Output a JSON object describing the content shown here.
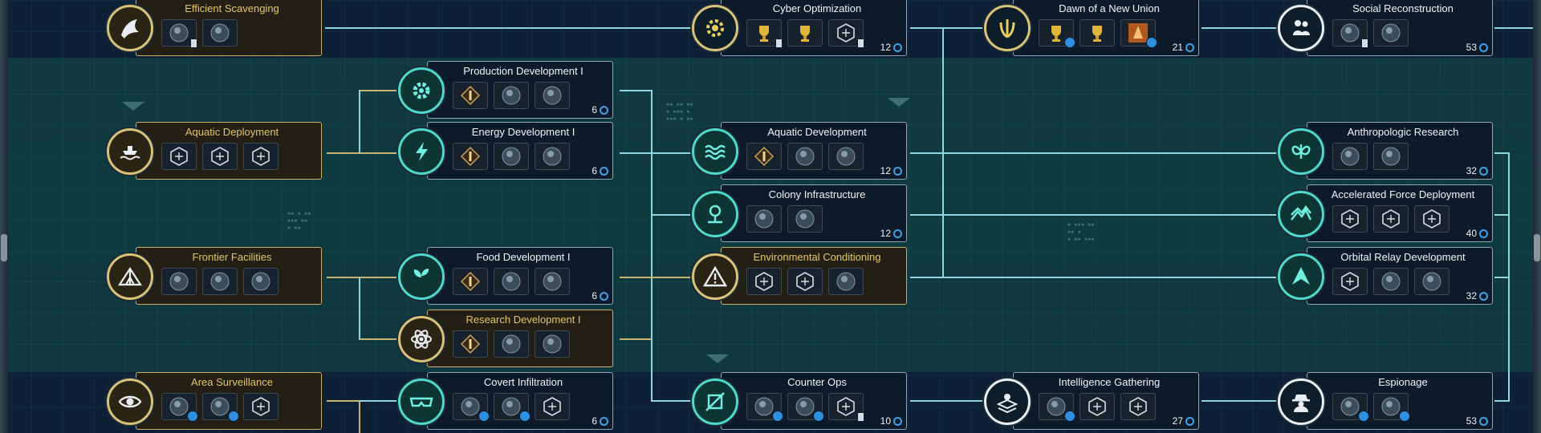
{
  "colors": {
    "completed_border": "#c9b06a",
    "completed_title": "#e3c667",
    "node_border": "#8da7b6",
    "link_cyan": "#8fd6e0",
    "link_gold": "#c9b470",
    "turn_icon": "#3ea2e8"
  },
  "nodes": {
    "efficient_scavenging": {
      "title": "Efficient Scavenging",
      "icon": "scavenger-bird-icon",
      "chips": [
        "atom-lab-icon",
        "skull-claw-icon"
      ]
    },
    "cyber_optimization": {
      "title": "Cyber Optimization",
      "icon": "gear-chip-icon",
      "chips": [
        "gold-crown-icon",
        "gold-gear-icon",
        "hex-cylinder-icon"
      ],
      "turns": "12"
    },
    "dawn_new_union": {
      "title": "Dawn of a New Union",
      "icon": "laurel-union-icon",
      "chips": [
        "trophy-icon",
        "trophy-icon",
        "orange-rocket-icon"
      ],
      "turns": "21"
    },
    "social_reconstruction": {
      "title": "Social Reconstruction",
      "icon": "people-cluster-icon",
      "chips": [
        "scaffold-icon",
        "sphere-icon"
      ],
      "turns": "53"
    },
    "production_dev_1": {
      "title": "Production Development I",
      "icon": "gear-icon",
      "chips": [
        "tier-one-badge-icon",
        "mine-icon",
        "factory-icon"
      ],
      "turns": "6"
    },
    "aquatic_deployment": {
      "title": "Aquatic Deployment",
      "icon": "ship-waves-icon",
      "chips": [
        "hex-building-icon",
        "hex-diamond-icon",
        "hex-cross-icon"
      ]
    },
    "energy_dev_1": {
      "title": "Energy Development I",
      "icon": "lightning-icon",
      "chips": [
        "tier-one-badge-icon",
        "solar-array-icon",
        "reactor-icon"
      ],
      "turns": "6"
    },
    "aquatic_development": {
      "title": "Aquatic Development",
      "icon": "waves-icon",
      "chips": [
        "tier-one-badge-icon",
        "sea-city-icon",
        "water-planet-icon"
      ],
      "turns": "12"
    },
    "anthropologic_research": {
      "title": "Anthropologic Research",
      "icon": "dna-butterfly-icon",
      "chips": [
        "tower-icon",
        "portal-arch-icon"
      ],
      "turns": "32"
    },
    "colony_infrastructure": {
      "title": "Colony Infrastructure",
      "icon": "colony-pin-icon",
      "chips": [
        "obelisk-icon",
        "structure-icon"
      ],
      "turns": "12"
    },
    "accelerated_force": {
      "title": "Accelerated Force Deployment",
      "icon": "mountain-arrow-icon",
      "chips": [
        "hex-tank-icon",
        "hex-spire-icon",
        "hex-layers-icon"
      ],
      "turns": "40"
    },
    "frontier_facilities": {
      "title": "Frontier Facilities",
      "icon": "tent-icon",
      "chips": [
        "spider-icon",
        "dome-helmet-icon",
        "ruins-icon"
      ]
    },
    "food_dev_1": {
      "title": "Food Development I",
      "icon": "leaf-icon",
      "chips": [
        "tier-one-badge-icon",
        "farm-planet-icon",
        "greenhouse-icon"
      ],
      "turns": "6"
    },
    "environmental_conditioning": {
      "title": "Environmental Conditioning",
      "icon": "warning-triangle-icon",
      "chips": [
        "hex-warning-icon",
        "hex-slab-icon",
        "dome-icon"
      ]
    },
    "orbital_relay": {
      "title": "Orbital Relay Development",
      "icon": "arrow-up-icon",
      "chips": [
        "hex-arrow-icon",
        "fighter-ship-icon",
        "relay-planet-icon"
      ],
      "turns": "32"
    },
    "research_dev_1": {
      "title": "Research Development I",
      "icon": "atom-icon",
      "chips": [
        "tier-one-badge-icon",
        "research-dome-icon",
        "lab-sphere-icon"
      ]
    },
    "area_surveillance": {
      "title": "Area Surveillance",
      "icon": "eye-icon",
      "chips": [
        "radar-icon",
        "beacon-icon",
        "hex-tower-icon"
      ]
    },
    "covert_infiltration": {
      "title": "Covert Infiltration",
      "icon": "goggles-icon",
      "chips": [
        "crosshair-agent-icon",
        "glove-icon",
        "hex-mask-icon"
      ],
      "turns": "6"
    },
    "counter_ops": {
      "title": "Counter Ops",
      "icon": "slashed-badge-icon",
      "chips": [
        "crossed-wrench-icon",
        "crossed-tools-icon",
        "hex-eye-icon"
      ],
      "turns": "10"
    },
    "intelligence_gathering": {
      "title": "Intelligence Gathering",
      "icon": "stacked-person-icon",
      "chips": [
        "person-icon",
        "hex-cube-icon",
        "hex-shard-icon"
      ],
      "turns": "27"
    },
    "espionage": {
      "title": "Espionage",
      "icon": "hooded-spy-icon",
      "chips": [
        "spy-mask-icon",
        "lightning-doc-icon"
      ],
      "turns": "53"
    }
  }
}
